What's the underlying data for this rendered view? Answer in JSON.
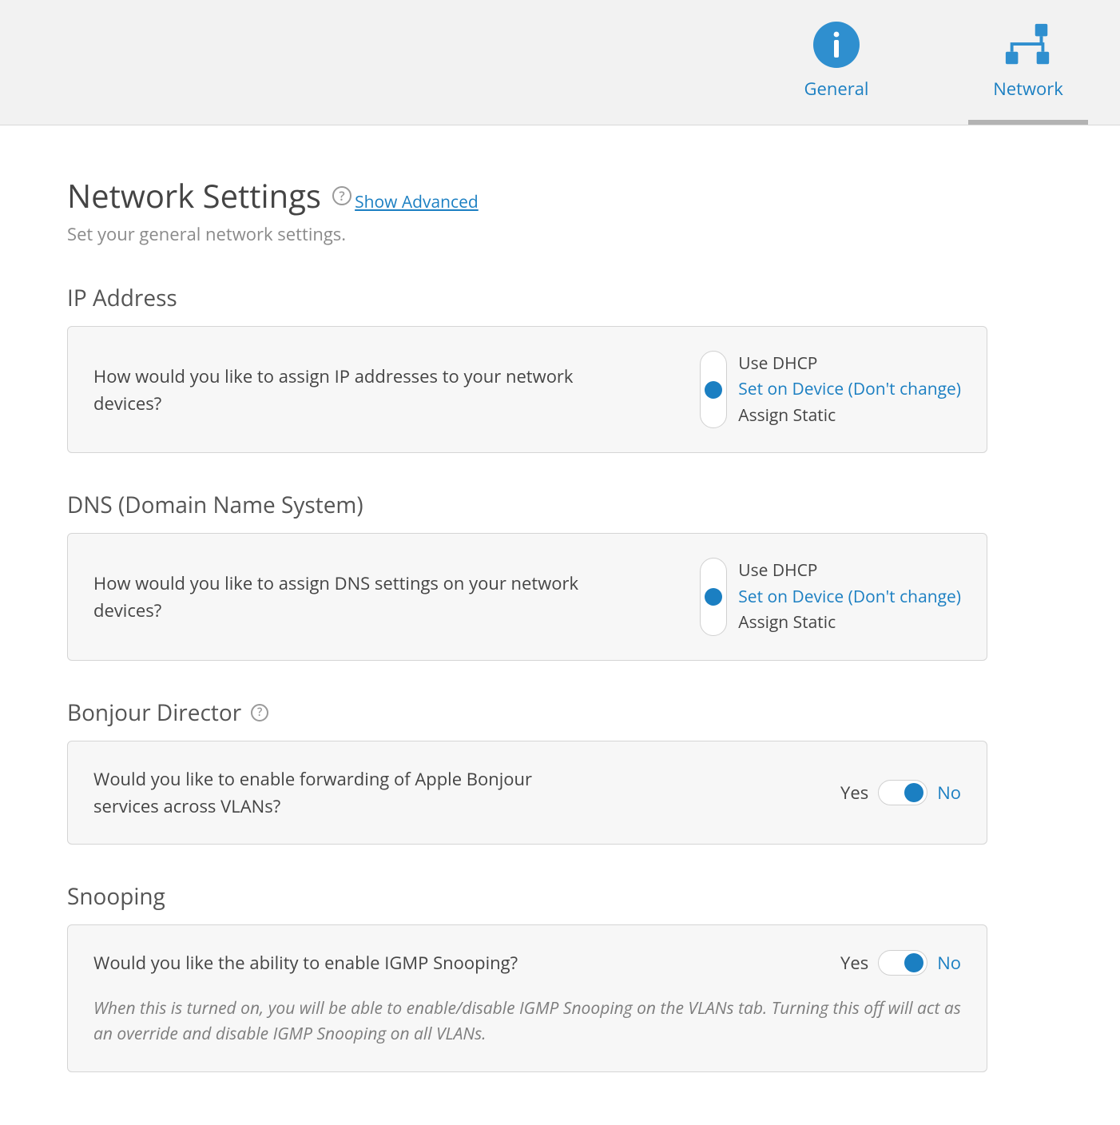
{
  "tabs": {
    "general": "General",
    "network": "Network",
    "active": "network"
  },
  "page": {
    "title": "Network Settings",
    "show_advanced": "Show Advanced",
    "subtitle": "Set your general network settings."
  },
  "sections": {
    "ip": {
      "heading": "IP Address",
      "question": "How would you like to assign IP addresses to your network devices?",
      "options": [
        "Use DHCP",
        "Set on Device (Don't change)",
        "Assign Static"
      ],
      "selected_index": 1
    },
    "dns": {
      "heading": "DNS (Domain Name System)",
      "question": "How would you like to assign DNS settings on your network devices?",
      "options": [
        "Use DHCP",
        "Set on Device (Don't change)",
        "Assign Static"
      ],
      "selected_index": 1
    },
    "bonjour": {
      "heading": "Bonjour Director",
      "question": "Would you like to enable forwarding of Apple Bonjour services across VLANs?",
      "yes": "Yes",
      "no": "No",
      "value": "no"
    },
    "snooping": {
      "heading": "Snooping",
      "question": "Would you like the ability to enable IGMP Snooping?",
      "yes": "Yes",
      "no": "No",
      "value": "no",
      "hint": "When this is turned on, you will be able to enable/disable IGMP Snooping on the VLANs tab. Turning this off will act as an override and disable IGMP Snooping on all VLANs."
    }
  }
}
